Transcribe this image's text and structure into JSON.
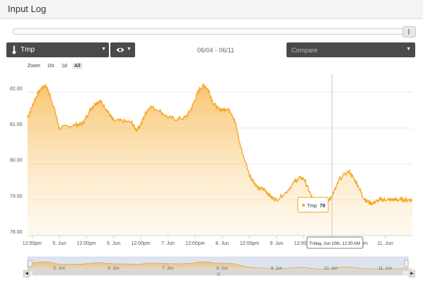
{
  "window": {
    "title": "Input Log"
  },
  "controls": {
    "sensor": {
      "label": "Tmp"
    },
    "date_range": "06/04 - 06/11",
    "compare": {
      "placeholder": "Compare"
    }
  },
  "zoom": {
    "label": "Zoom",
    "options": [
      "1hr",
      "1d",
      "All"
    ],
    "selected": "All"
  },
  "tooltip": {
    "series": "Tmp",
    "value": "79"
  },
  "crosshair_label": "Friday, Jun 10th, 12:30 AM",
  "colors": {
    "series": "#f5a623",
    "panel": "#4a4a4a",
    "navigator_fill": "#dde3ef"
  },
  "navigator": {
    "labels": [
      "5. Jun",
      "6. Jun",
      "7. Jun",
      "8. Jun",
      "9. Jun",
      "10. Jun",
      "11. Jun"
    ]
  },
  "chart_data": {
    "type": "area",
    "title": "",
    "xlabel": "",
    "ylabel": "",
    "ylim": [
      78.0,
      82.5
    ],
    "xlim": [
      "2016-06-04 10:00",
      "2016-06-11 12:00"
    ],
    "y_ticks": [
      "82.00",
      "81.00",
      "80.00",
      "79.00",
      "78.00"
    ],
    "x_ticks": [
      "12:00pm",
      "5. Jun",
      "12:00pm",
      "6. Jun",
      "12:00pm",
      "7. Jun",
      "12:00pm",
      "8. Jun",
      "12:00pm",
      "9. Jun",
      "12:00pm",
      "10. Jun",
      "12:00pm",
      "11. Jun"
    ],
    "series": [
      {
        "name": "Tmp",
        "x": [
          "06-04 10:00",
          "06-04 12:00",
          "06-04 14:00",
          "06-04 16:00",
          "06-04 18:00",
          "06-04 20:00",
          "06-04 22:00",
          "06-05 00:00",
          "06-05 04:00",
          "06-05 08:00",
          "06-05 10:00",
          "06-05 12:00",
          "06-05 14:00",
          "06-05 16:00",
          "06-05 18:00",
          "06-05 20:00",
          "06-05 22:00",
          "06-06 00:00",
          "06-06 04:00",
          "06-06 08:00",
          "06-06 10:00",
          "06-06 12:00",
          "06-06 14:00",
          "06-06 16:00",
          "06-06 20:00",
          "06-07 00:00",
          "06-07 04:00",
          "06-07 08:00",
          "06-07 10:00",
          "06-07 12:00",
          "06-07 14:00",
          "06-07 16:00",
          "06-07 18:00",
          "06-07 20:00",
          "06-07 22:00",
          "06-08 00:00",
          "06-08 02:00",
          "06-08 04:00",
          "06-08 06:00",
          "06-08 08:00",
          "06-08 12:00",
          "06-08 14:00",
          "06-08 16:00",
          "06-08 18:00",
          "06-08 20:00",
          "06-08 22:00",
          "06-09 00:00",
          "06-09 04:00",
          "06-09 08:00",
          "06-09 10:00",
          "06-09 12:00",
          "06-09 14:00",
          "06-09 16:00",
          "06-09 18:00",
          "06-09 20:00",
          "06-09 22:00",
          "06-10 00:00",
          "06-10 02:00",
          "06-10 04:00",
          "06-10 08:00",
          "06-10 10:00",
          "06-10 12:00",
          "06-10 14:00",
          "06-10 16:00",
          "06-10 18:00",
          "06-10 20:00",
          "06-10 22:00",
          "06-11 00:00",
          "06-11 02:00",
          "06-11 04:00",
          "06-11 06:00",
          "06-11 08:00",
          "06-11 10:00",
          "06-11 12:00"
        ],
        "y": [
          81.3,
          81.6,
          81.9,
          82.1,
          82.2,
          81.9,
          81.5,
          81.0,
          81.05,
          81.1,
          81.1,
          81.3,
          81.55,
          81.7,
          81.75,
          81.6,
          81.4,
          81.2,
          81.2,
          81.15,
          80.95,
          81.1,
          81.4,
          81.6,
          81.5,
          81.3,
          81.25,
          81.3,
          81.5,
          81.8,
          82.1,
          82.2,
          82.05,
          81.7,
          81.55,
          81.5,
          81.55,
          81.45,
          81.1,
          80.5,
          79.7,
          79.5,
          79.3,
          79.3,
          79.2,
          79.05,
          79.0,
          79.2,
          79.5,
          79.6,
          79.6,
          79.3,
          79.0,
          78.9,
          78.85,
          78.9,
          79.05,
          79.3,
          79.6,
          79.8,
          79.6,
          79.4,
          79.1,
          78.95,
          78.9,
          78.95,
          79.0,
          79.0,
          79.0,
          79.0,
          79.0,
          79.0,
          79.0,
          79.0
        ]
      }
    ]
  }
}
